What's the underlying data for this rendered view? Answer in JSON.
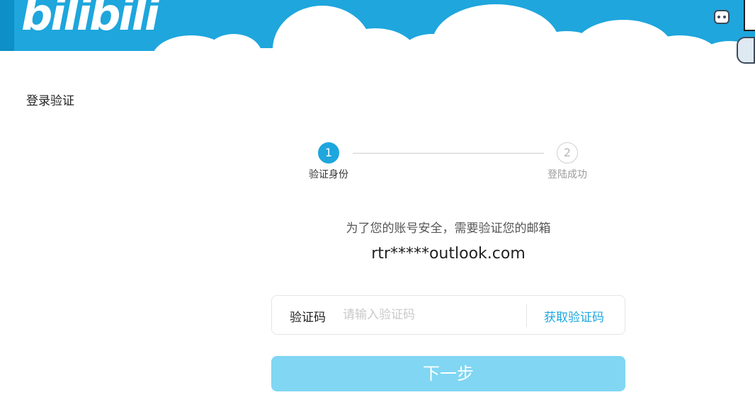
{
  "header": {
    "logo_text": "bilibili"
  },
  "page": {
    "title": "登录验证"
  },
  "stepper": {
    "steps": [
      {
        "number": "1",
        "label": "验证身份",
        "state": "active"
      },
      {
        "number": "2",
        "label": "登陆成功",
        "state": "inactive"
      }
    ]
  },
  "verification": {
    "notice": "为了您的账号安全，需要验证您的邮箱",
    "email": "rtr*****outlook.com",
    "code_label": "验证码",
    "code_placeholder": "请输入验证码",
    "code_value": "",
    "get_code_label": "获取验证码",
    "next_label": "下一步"
  },
  "colors": {
    "brand_blue": "#1ea6dd",
    "button_disabled": "#80d6f3",
    "banner_bg": "#1ea6dd"
  }
}
